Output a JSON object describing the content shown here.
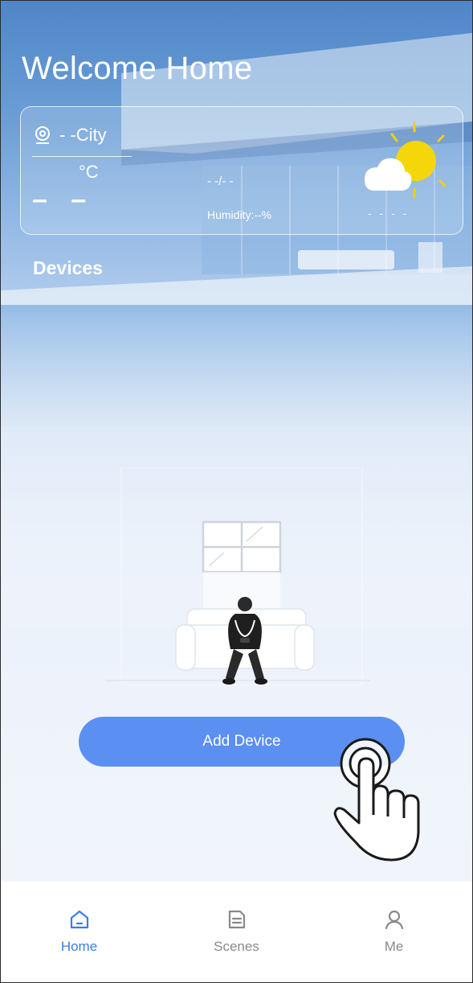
{
  "header": {
    "title": "Welcome Home"
  },
  "weather": {
    "city": "- -City",
    "unit": "°C",
    "temperature": "– –",
    "date": "- -/- -",
    "humidity": "Humidity:--%",
    "wind": "- - - -",
    "icon": "partly-cloudy-icon"
  },
  "section": {
    "devices_label": "Devices"
  },
  "actions": {
    "add_device_label": "Add Device"
  },
  "tabbar": {
    "items": [
      {
        "label": "Home",
        "icon": "home-icon",
        "active": true
      },
      {
        "label": "Scenes",
        "icon": "scenes-icon",
        "active": false
      },
      {
        "label": "Me",
        "icon": "profile-icon",
        "active": false
      }
    ]
  },
  "colors": {
    "accent": "#3c7de8",
    "button": "#5b8ff2",
    "inactive": "#8a8a8a"
  }
}
